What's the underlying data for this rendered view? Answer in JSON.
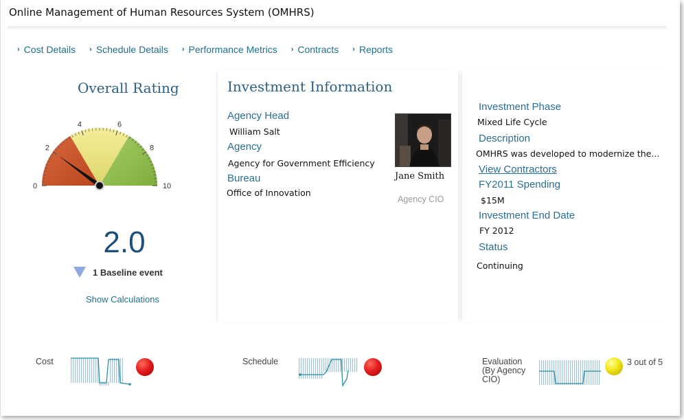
{
  "app": {
    "title": "Online Management of Human Resources System (OMHRS)"
  },
  "nav": [
    {
      "label": "Cost Details"
    },
    {
      "label": "Schedule Details"
    },
    {
      "label": "Performance Metrics"
    },
    {
      "label": "Contracts"
    },
    {
      "label": "Reports"
    }
  ],
  "rating": {
    "heading": "Overall Rating",
    "score": "2.0",
    "score_value": 2.0,
    "gauge_ticks": [
      "0",
      "2",
      "4",
      "6",
      "8",
      "10"
    ],
    "baseline_text": "1 Baseline event",
    "show_calculations": "Show Calculations",
    "colors": {
      "low": "#c6532c",
      "mid": "#e8e07a",
      "high": "#8db94a",
      "needle": "#111111"
    }
  },
  "investment": {
    "heading": "Investment Information",
    "agency_head_label": "Agency Head",
    "agency_head": "William Salt",
    "agency_label": "Agency",
    "agency": "Agency for Government Efficiency",
    "bureau_label": "Bureau",
    "bureau": "Office of Innovation",
    "person_name": "Jane Smith",
    "person_role": "Agency CIO"
  },
  "details": {
    "phase_label": "Investment Phase",
    "phase": "Mixed Life Cycle",
    "description_label": "Description",
    "description": "OMHRS was developed to modernize the...",
    "view_contractors": "View Contractors",
    "spending_label": "FY2011 Spending",
    "spending": "$15M",
    "end_date_label": "Investment End Date",
    "end_date": "FY 2012",
    "status_label": "Status",
    "status": "Continuing"
  },
  "summary": {
    "cost_label": "Cost",
    "cost_status": "red",
    "schedule_label": "Schedule",
    "schedule_status": "red",
    "evaluation_label_1": "Evaluation",
    "evaluation_label_2": "(By Agency",
    "evaluation_label_3": "CIO)",
    "evaluation_status": "yellow",
    "evaluation_score": "3 out of 5"
  }
}
